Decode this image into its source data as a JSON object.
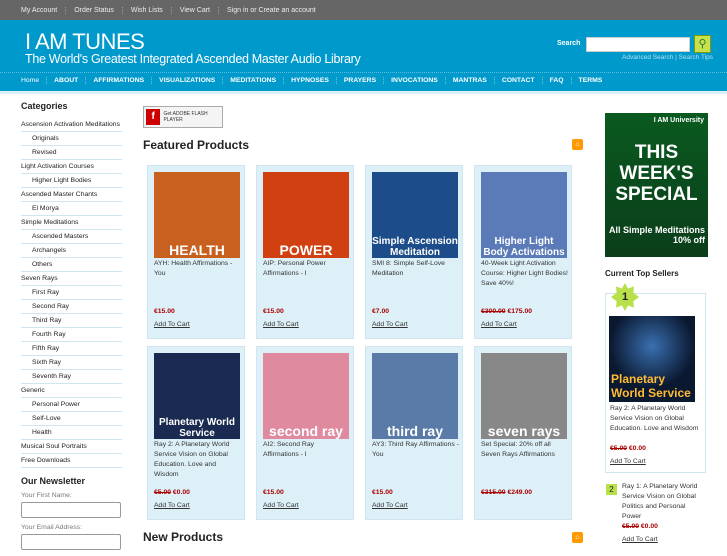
{
  "topbar": [
    "My Account",
    "Order Status",
    "Wish Lists",
    "View Cart",
    "Sign in or Create an account"
  ],
  "header": {
    "title": "I AM TUNES",
    "tagline": "The World's Greatest Integrated Ascended Master Audio Library",
    "search_label": "Search",
    "search_value": "",
    "advanced_search": "Advanced Search",
    "search_tips": "Search Tips"
  },
  "nav": [
    "Home",
    "ABOUT",
    "AFFIRMATIONS",
    "VISUALIZATIONS",
    "MEDITATIONS",
    "HYPNOSES",
    "PRAYERS",
    "INVOCATIONS",
    "MANTRAS",
    "CONTACT",
    "FAQ",
    "TERMS"
  ],
  "sidebar": {
    "title": "Categories",
    "items": [
      {
        "label": "Ascension Activation Meditations",
        "sub": false
      },
      {
        "label": "Originals",
        "sub": true
      },
      {
        "label": "Revised",
        "sub": true
      },
      {
        "label": "Light Activation Courses",
        "sub": false
      },
      {
        "label": "Higher Light Bodies",
        "sub": true
      },
      {
        "label": "Ascended Master Chants",
        "sub": false
      },
      {
        "label": "El Morya",
        "sub": true
      },
      {
        "label": "Simple Meditations",
        "sub": false
      },
      {
        "label": "Ascended Masters",
        "sub": true
      },
      {
        "label": "Archangels",
        "sub": true
      },
      {
        "label": "Others",
        "sub": true
      },
      {
        "label": "Seven Rays",
        "sub": false
      },
      {
        "label": "First Ray",
        "sub": true
      },
      {
        "label": "Second Ray",
        "sub": true
      },
      {
        "label": "Third Ray",
        "sub": true
      },
      {
        "label": "Fourth Ray",
        "sub": true
      },
      {
        "label": "Fifth Ray",
        "sub": true
      },
      {
        "label": "Sixth Ray",
        "sub": true
      },
      {
        "label": "Seventh Ray",
        "sub": true
      },
      {
        "label": "Generic",
        "sub": false
      },
      {
        "label": "Personal Power",
        "sub": true
      },
      {
        "label": "Self-Love",
        "sub": true
      },
      {
        "label": "Health",
        "sub": true
      },
      {
        "label": "Musical Soul Portraits",
        "sub": false
      },
      {
        "label": "Free Downloads",
        "sub": false
      }
    ],
    "newsletter": {
      "title": "Our Newsletter",
      "first_name_label": "Your First Name:",
      "email_label": "Your Email Address:"
    }
  },
  "flash": {
    "label": "Get ADOBE FLASH PLAYER"
  },
  "featured": {
    "title": "Featured Products",
    "add_label": "Add To Cart",
    "products": [
      {
        "name": "AYH: Health Affirmations - You",
        "old": "",
        "price": "€15.00",
        "art": "HEALTH",
        "bg": "#c86020",
        "cart": true
      },
      {
        "name": "AIP: Personal Power Affirmations - I",
        "old": "",
        "price": "€15.00",
        "art": "POWER",
        "bg": "#d04010",
        "cart": true
      },
      {
        "name": "SMI 8: Simple Self-Love Meditation",
        "old": "",
        "price": "€7.00",
        "art": "Simple Ascension Meditation",
        "bg": "#1d4c8a",
        "cart": true
      },
      {
        "name": "40-Week Light Activation Course: Higher Light Bodies! Save 40%!",
        "old": "€300.00",
        "price": "€175.00",
        "art": "Higher Light Body Activations",
        "bg": "#5a7ab8",
        "cart": true
      },
      {
        "name": "Ray 2: A Planetary World Service Vision on Global Education. Love and Wisdom",
        "old": "€5.00",
        "price": "€0.00",
        "art": "Planetary World Service",
        "bg": "#1a2a50",
        "cart": true
      },
      {
        "name": "AI2: Second Ray Affirmations - I",
        "old": "",
        "price": "€15.00",
        "art": "second ray",
        "bg": "#e08aa0",
        "cart": true
      },
      {
        "name": "AY3: Third Ray Affirmations - You",
        "old": "",
        "price": "€15.00",
        "art": "third ray",
        "bg": "#5a7aa8",
        "cart": true
      },
      {
        "name": "Set Special: 20% off all Seven Rays Affirmations",
        "old": "€315.00",
        "price": "€249.00",
        "art": "seven rays",
        "bg": "#888",
        "cart": false
      }
    ]
  },
  "new_products": {
    "title": "New Products"
  },
  "promo": {
    "brand": "I AM University",
    "headline": "THIS WEEK'S SPECIAL",
    "offer": "All Simple Meditations 10% off"
  },
  "top_sellers": {
    "title": "Current Top Sellers",
    "items": [
      {
        "rank": "1",
        "name": "Ray 2: A Planetary World Service Vision on Global Education. Love and Wisdom",
        "old": "€5.00",
        "price": "€0.00",
        "add": "Add To Cart"
      },
      {
        "rank": "2",
        "name": "Ray 1: A Planetary World Service Vision on Global Politics and Personal Power",
        "old": "€5.00",
        "price": "€0.00",
        "add": "Add To Cart"
      }
    ]
  }
}
